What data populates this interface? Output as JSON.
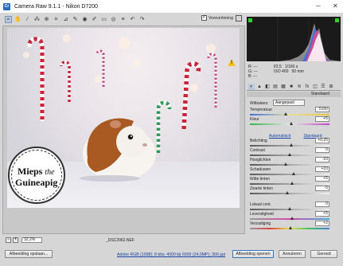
{
  "window": {
    "title": "Camera Raw 9.1.1  -  Nikon D7200",
    "minimize": "─",
    "close": "✕"
  },
  "toolbar": {
    "preview_label": "Voorvertoning",
    "preview_checked": "✓",
    "tools": [
      "zoom-icon",
      "hand-icon",
      "white-balance-icon",
      "color-sampler-icon",
      "target-adjust-icon",
      "crop-icon",
      "straighten-icon",
      "spot-removal-icon",
      "red-eye-icon",
      "adjustment-brush-icon",
      "graduated-filter-icon",
      "radial-filter-icon",
      "preferences-icon",
      "rotate-ccw-icon",
      "rotate-cw-icon"
    ],
    "tool_glyphs": [
      "⌕",
      "✋",
      "⁄",
      "⁂",
      "⊕",
      "⌗",
      "⊿",
      "✎",
      "◉",
      "✐",
      "▭",
      "◎",
      "≡",
      "↶",
      "↷"
    ]
  },
  "canvas": {
    "warning_glyph": "!",
    "logo_line1": "Mieps",
    "logo_line1_suffix": "the",
    "logo_line2": "Guineapig"
  },
  "status": {
    "zoom_minus": "−",
    "zoom_plus": "+",
    "zoom_value": "32,2%",
    "filename": "_DSC2962.NEF"
  },
  "bottom": {
    "save_button": "Afbeelding opslaan...",
    "info_link": "Adobe RGB (1998); 8 bits; 4000 bij 6000 (24,0MP); 300 ppi",
    "open_button": "Afbeelding openen",
    "cancel_button": "Annuleren",
    "done_button": "Gereed"
  },
  "panel": {
    "exif": {
      "r_label": "R:",
      "g_label": "G:",
      "b_label": "B:",
      "r_value": "---",
      "g_value": "---",
      "b_value": "---",
      "aperture": "f/2,5",
      "shutter": "1/160 s",
      "iso": "ISO 400",
      "focal": "50 mm"
    },
    "tab_glyphs": [
      "◐",
      "▲",
      "◧",
      "▤",
      "▦",
      "■",
      "≋",
      "fx",
      "◫",
      "☰",
      "⊞"
    ],
    "section_title": "Standaard",
    "wb_label": "Witbalans:",
    "wb_value": "Aangepast",
    "auto_label": "Automatisch",
    "default_label": "Standaard",
    "sliders": [
      {
        "label": "Temperatuur",
        "value": "5150",
        "position": 0.45,
        "track": "temp"
      },
      {
        "label": "Kleur",
        "value": "+5",
        "position": 0.52,
        "track": "tint"
      },
      {
        "label": "Belichting",
        "value": "+0,25",
        "position": 0.52,
        "track": "gray"
      },
      {
        "label": "Contrast",
        "value": "0",
        "position": 0.5,
        "track": "gray"
      },
      {
        "label": "Hooglichten",
        "value": "-10",
        "position": 0.45,
        "track": "gray"
      },
      {
        "label": "Schaduwen",
        "value": "+10",
        "position": 0.55,
        "track": "gray"
      },
      {
        "label": "Witte tinten",
        "value": "+5",
        "position": 0.53,
        "track": "gray"
      },
      {
        "label": "Zwarte tinten",
        "value": "-5",
        "position": 0.47,
        "track": "gray"
      },
      {
        "label": "Lokaal cont.",
        "value": "0",
        "position": 0.5,
        "track": "gray"
      },
      {
        "label": "Levendigheid",
        "value": "+5",
        "position": 0.53,
        "track": "vib"
      },
      {
        "label": "Verzadiging",
        "value": "+2",
        "position": 0.51,
        "track": "sat"
      }
    ]
  }
}
